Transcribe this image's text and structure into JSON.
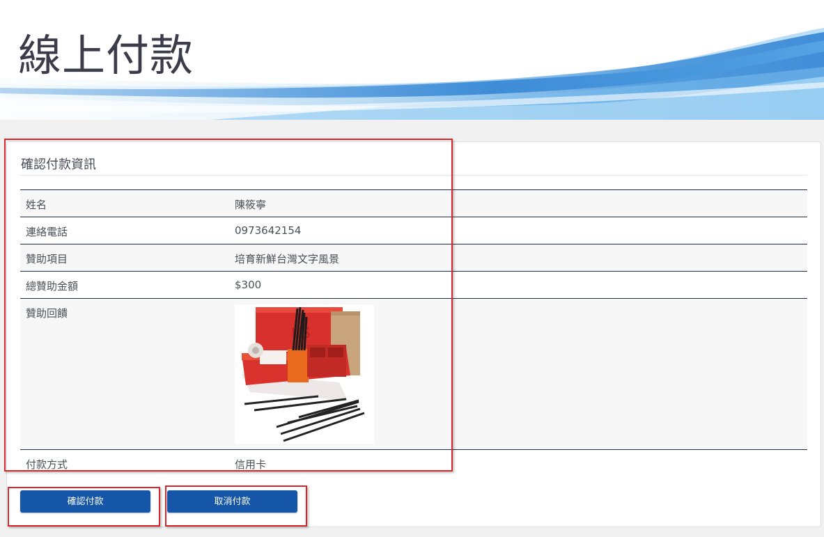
{
  "page": {
    "title": "線上付款"
  },
  "section": {
    "title": "確認付款資訊"
  },
  "info": {
    "name_label": "姓名",
    "name_value": "陳筱寧",
    "phone_label": "連絡電話",
    "phone_value": "0973642154",
    "item_label": "贊助項目",
    "item_value": "培育新鮮台灣文字風景",
    "amount_label": "總贊助金額",
    "amount_value": "$300",
    "reward_label": "贊助回饋",
    "payment_label": "付款方式",
    "payment_value": "信用卡"
  },
  "buttons": {
    "confirm_label": "確認付款",
    "cancel_label": "取消付款"
  },
  "colors": {
    "button_blue": "#1556a8",
    "annotation_red": "#d9262c",
    "banner_blue": "#3d8fd9",
    "row_border": "#1e2a3e"
  },
  "icons": {
    "reward_image": "nike-desk-organizer-with-pencils-photo"
  }
}
